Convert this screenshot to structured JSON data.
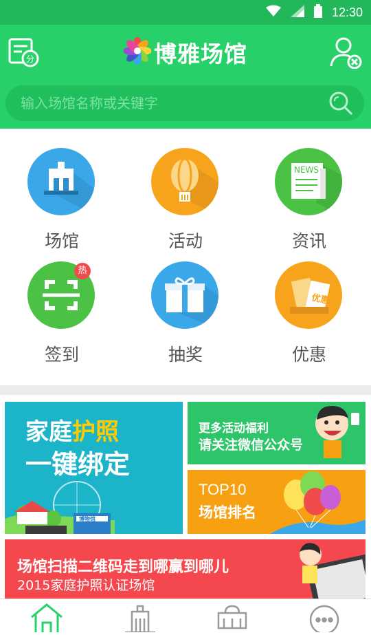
{
  "status_bar": {
    "time": "12:30",
    "icons": [
      "wifi-icon",
      "signal-icon",
      "battery-icon"
    ]
  },
  "header": {
    "title": "博雅场馆",
    "left_icon": "points-card-icon",
    "right_icon": "user-settings-icon",
    "search": {
      "placeholder": "输入场馆名称或关键字",
      "value": "",
      "icon": "search-icon"
    }
  },
  "menu": [
    {
      "label": "场馆",
      "icon": "building-icon",
      "color": "#3aa7e8"
    },
    {
      "label": "活动",
      "icon": "balloon-icon",
      "color": "#f7a41c"
    },
    {
      "label": "资讯",
      "icon": "news-icon",
      "color": "#4cc245",
      "icon_text": "NEWS"
    },
    {
      "label": "签到",
      "icon": "scan-icon",
      "color": "#4cc245",
      "badge": "热"
    },
    {
      "label": "抽奖",
      "icon": "gift-icon",
      "color": "#3aa7e8"
    },
    {
      "label": "优惠",
      "icon": "coupon-icon",
      "color": "#f7a41c",
      "icon_text": "优惠"
    }
  ],
  "banners": {
    "family": {
      "line1_a": "家庭",
      "line1_b": "护照",
      "line2": "一键绑定",
      "sign": "博物馆"
    },
    "follow": {
      "line1": "更多活动福利",
      "line2": "请关注微信公众号"
    },
    "top10": {
      "line1": "TOP10",
      "line2": "场馆排名"
    },
    "scan": {
      "line1": "场馆扫描二维码走到哪赢到哪儿",
      "line2": "2015家庭护照认证场馆"
    }
  },
  "bottom_nav": [
    {
      "icon": "home-icon",
      "active": true
    },
    {
      "icon": "venue-icon",
      "active": false
    },
    {
      "icon": "activity-icon",
      "active": false
    },
    {
      "icon": "more-icon",
      "active": false
    }
  ],
  "colors": {
    "primary": "#27d068",
    "status_bar": "#22b85a",
    "hot": "#f04b4b"
  }
}
